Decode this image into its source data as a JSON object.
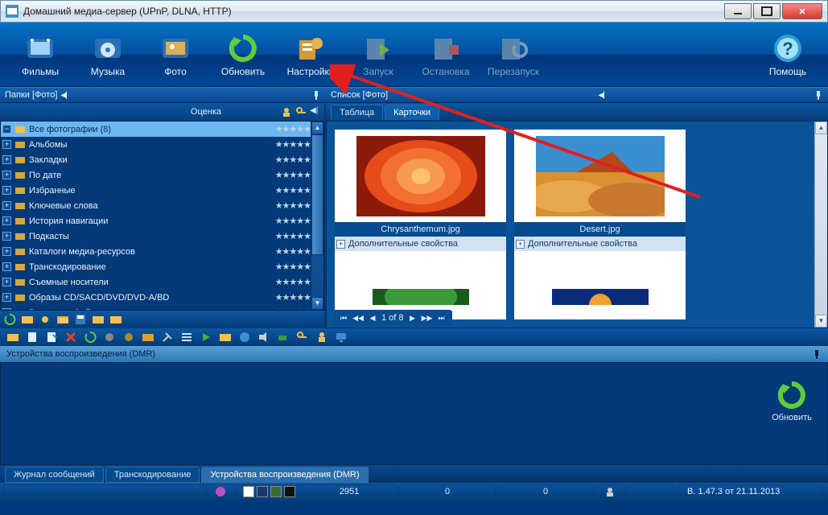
{
  "window": {
    "title": "Домашний медиа-сервер (UPnP, DLNA, HTTP)"
  },
  "toolbar": {
    "films": "Фильмы",
    "music": "Музыка",
    "photo": "Фото",
    "refresh": "Обновить",
    "settings": "Настройки",
    "start": "Запуск",
    "stop": "Остановка",
    "restart": "Перезапуск",
    "help": "Помощь"
  },
  "leftpanel": {
    "header": "Папки [Фото]",
    "rating_col": "Оценка",
    "items": [
      {
        "label": "Все фотографии (8)",
        "selected": true
      },
      {
        "label": "Альбомы"
      },
      {
        "label": "Закладки"
      },
      {
        "label": "По дате"
      },
      {
        "label": "Избранные"
      },
      {
        "label": "Ключевые слова"
      },
      {
        "label": "История навигации"
      },
      {
        "label": "Подкасты"
      },
      {
        "label": "Каталоги медиа-ресурсов"
      },
      {
        "label": "Транскодирование"
      },
      {
        "label": "Съемные носители"
      },
      {
        "label": "Образы CD/SACD/DVD/DVD-A/BD"
      },
      {
        "label": "Входящие файлы"
      }
    ]
  },
  "rightpanel": {
    "header": "Список [Фото]",
    "tab_table": "Таблица",
    "tab_cards": "Карточки",
    "pager": "1 of 8",
    "props_label": "Дополнительные свойства",
    "cards": [
      {
        "filename": "Chrysanthemum.jpg"
      },
      {
        "filename": "Desert.jpg"
      }
    ]
  },
  "dmr": {
    "header": "Устройства воспроизведения (DMR)",
    "refresh": "Обновить"
  },
  "bottomtabs": {
    "log": "Журнал сообщений",
    "transcode": "Транскодирование",
    "dmr": "Устройства воспроизведения (DMR)"
  },
  "status": {
    "count1": "2951",
    "count2": "0",
    "count3": "0",
    "version": "В. 1.47.3 от 21.11.2013"
  }
}
